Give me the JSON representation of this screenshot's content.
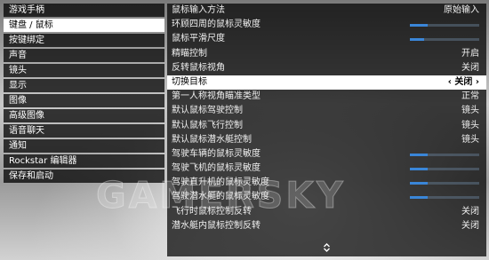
{
  "sidebar": {
    "items": [
      {
        "label": "游戏手柄"
      },
      {
        "label": "键盘 / 鼠标"
      },
      {
        "label": "按键绑定"
      },
      {
        "label": "声音"
      },
      {
        "label": "镜头"
      },
      {
        "label": "显示"
      },
      {
        "label": "图像"
      },
      {
        "label": "高级图像"
      },
      {
        "label": "语音聊天"
      },
      {
        "label": "通知"
      },
      {
        "label": "Rockstar 编辑器"
      },
      {
        "label": "保存和启动"
      }
    ],
    "selected_index": 1
  },
  "settings": {
    "rows": [
      {
        "label": "鼠标输入方法",
        "value": "原始输入"
      },
      {
        "label": "环顾四周的鼠标灵敏度",
        "slider": 0.25
      },
      {
        "label": "鼠标平滑尺度",
        "slider": 0.2
      },
      {
        "label": "精瞄控制",
        "value": "开启"
      },
      {
        "label": "反转鼠标视角",
        "value": "关闭"
      },
      {
        "label": "切换目标",
        "value": "‹ 关闭 ›"
      },
      {
        "label": "第一人称视角瞄准类型",
        "value": "正常"
      },
      {
        "label": "默认鼠标驾驶控制",
        "value": "镜头"
      },
      {
        "label": "默认鼠标飞行控制",
        "value": "镜头"
      },
      {
        "label": "默认鼠标潜水艇控制",
        "value": "镜头"
      },
      {
        "label": "驾驶车辆的鼠标灵敏度",
        "slider": 0.25
      },
      {
        "label": "驾驶飞机的鼠标灵敏度",
        "slider": 0.25
      },
      {
        "label": "驾驶直升机的鼠标灵敏度",
        "slider": 0.25
      },
      {
        "label": "驾驶潜水艇的鼠标灵敏度",
        "slider": 0.25
      },
      {
        "label": "飞行时鼠标控制反转",
        "value": "关闭"
      },
      {
        "label": "潜水艇内鼠标控制反转",
        "value": "关闭"
      }
    ],
    "selected_index": 5,
    "scroll_icon": "up-down-arrows-icon",
    "slider_fill_color": "#3a86d8"
  },
  "watermark": {
    "text": "GAMERSKY"
  }
}
